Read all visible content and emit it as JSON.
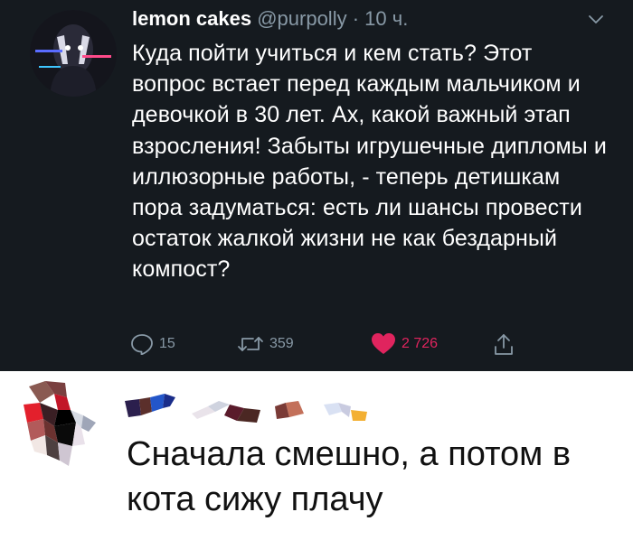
{
  "tweet": {
    "author": "lemon cakes",
    "handle": "@purpolly",
    "separator": "·",
    "time": "10 ч.",
    "text": "Куда пойти учиться и кем стать? Этот вопрос встает перед каждым мальчиком и девочкой в 30 лет. Ах, какой важный этап взросления! Забыты игрушечные дипломы и иллюзорные работы, - теперь детишкам пора задуматься: есть ли шансы провести остаток жалкой жизни не как бездарный компост?",
    "actions": {
      "replies": "15",
      "retweets": "359",
      "likes": "2 726"
    }
  },
  "comment": {
    "text": "Сначала смешно, а потом в кота сижу плачу"
  },
  "colors": {
    "tweet_background": "#151a1f",
    "secondary_text": "#8899a6",
    "like_accent": "#e0245e"
  }
}
